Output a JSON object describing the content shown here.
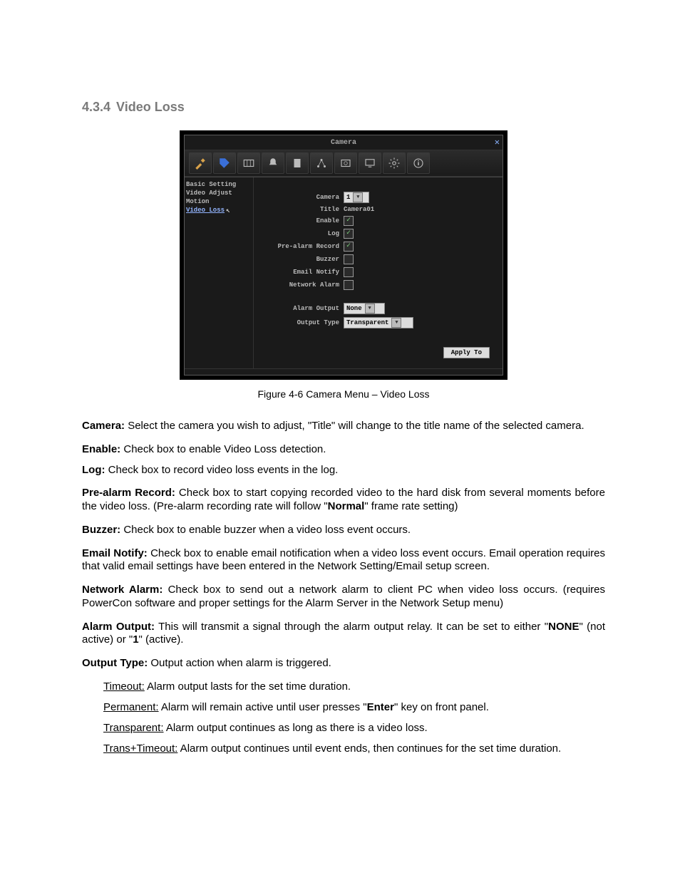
{
  "heading": {
    "number": "4.3.4",
    "title": "Video Loss"
  },
  "screenshot": {
    "window_title": "Camera",
    "toolbar_icons": [
      "wrench-icon",
      "tag-icon",
      "grid-icon",
      "bell-icon",
      "doc-icon",
      "network-icon",
      "photo-icon",
      "monitor-icon",
      "gear-icon",
      "info-icon"
    ],
    "sidebar": {
      "items": [
        "Basic Setting",
        "Video Adjust",
        "Motion",
        "Video Loss"
      ],
      "selected_index": 3
    },
    "fields": {
      "camera_label": "Camera",
      "camera_value": "1",
      "title_label": "Title",
      "title_value": "Camera01",
      "enable_label": "Enable",
      "enable_checked": true,
      "log_label": "Log",
      "log_checked": true,
      "prealarm_label": "Pre-alarm Record",
      "prealarm_checked": true,
      "buzzer_label": "Buzzer",
      "buzzer_checked": false,
      "email_label": "Email Notify",
      "email_checked": false,
      "network_label": "Network Alarm",
      "network_checked": false,
      "alarm_output_label": "Alarm Output",
      "alarm_output_value": "None",
      "output_type_label": "Output Type",
      "output_type_value": "Transparent"
    },
    "apply_button": "Apply To"
  },
  "caption": "Figure 4-6 Camera Menu – Video Loss",
  "descriptions": {
    "camera": {
      "label": "Camera:",
      "text": " Select the camera you wish to adjust, \"Title\" will change to the title name of the selected camera."
    },
    "enable": {
      "label": "Enable:",
      "text": " Check box to enable Video Loss detection."
    },
    "log": {
      "label": "Log:",
      "text": " Check box to record video loss events in the log."
    },
    "prealarm": {
      "label": "Pre-alarm Record:",
      "text1": " Check box to start copying recorded video to the hard disk from several moments before the video loss. (Pre-alarm recording rate will follow \"",
      "normal": "Normal",
      "text2": "\" frame rate setting)"
    },
    "buzzer": {
      "label": "Buzzer:",
      "text": " Check box to enable buzzer when a video loss event occurs."
    },
    "email": {
      "label": "Email Notify:",
      "text": " Check box to enable email notification when a video loss event occurs. Email operation requires that valid email settings have been entered in the Network Setting/Email setup screen."
    },
    "netalarm": {
      "label": "Network Alarm:",
      "text": " Check box to send out a network alarm to client PC when video loss occurs. (requires PowerCon software and proper settings for the Alarm Server in the Network Setup menu)"
    },
    "alarmout": {
      "label": "Alarm Output:",
      "text1": " This will transmit a signal through the alarm output relay. It can be set to either \"",
      "none": "NONE",
      "text2": "\" (not active) or \"",
      "one": "1",
      "text3": "\" (active)."
    },
    "outtype": {
      "label": "Output Type:",
      "text": " Output action when alarm is triggered."
    }
  },
  "subitems": {
    "timeout": {
      "label": "Timeout:",
      "text": " Alarm output lasts for the set time duration."
    },
    "permanent": {
      "label": "Permanent:",
      "text1": " Alarm will remain active until user presses \"",
      "enter": "Enter",
      "text2": "\" key on front panel."
    },
    "transparent": {
      "label": "Transparent:",
      "text": " Alarm output continues as long as there is a video loss."
    },
    "transtime": {
      "label": "Trans+Timeout:",
      "text": " Alarm output continues until event ends, then continues for the set time duration."
    }
  }
}
